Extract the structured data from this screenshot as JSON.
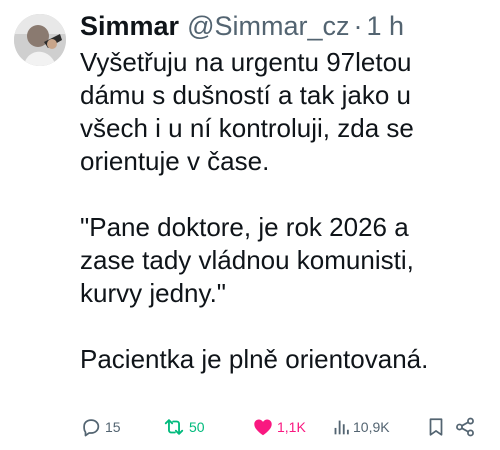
{
  "tweet": {
    "author": {
      "display_name": "Simmar",
      "handle": "@Simmar_cz",
      "separator": "·",
      "time": "1 h"
    },
    "paragraphs": [
      "Vyšetřuju na urgentu 97letou\ndámu s dušností a tak jako u\nvšech i u ní kontroluji, zda se\norientuje v čase.",
      "\"Pane doktore, je rok 2026 a\nzase tady vládnou komunisti,\nkurvy jedny.\"",
      "Pacientka je plně orientovaná."
    ],
    "actions": {
      "replies": "15",
      "retweets": "50",
      "likes": "1,1K",
      "views": "10,9K"
    },
    "icons": {
      "reply": "reply-icon",
      "retweet": "retweet-icon",
      "like": "heart-icon",
      "views": "views-icon",
      "bookmark": "bookmark-icon",
      "share": "share-icon"
    },
    "colors": {
      "text": "#0f1419",
      "muted": "#536471",
      "retweet_active": "#00ba7c",
      "like_active": "#f91880"
    }
  }
}
